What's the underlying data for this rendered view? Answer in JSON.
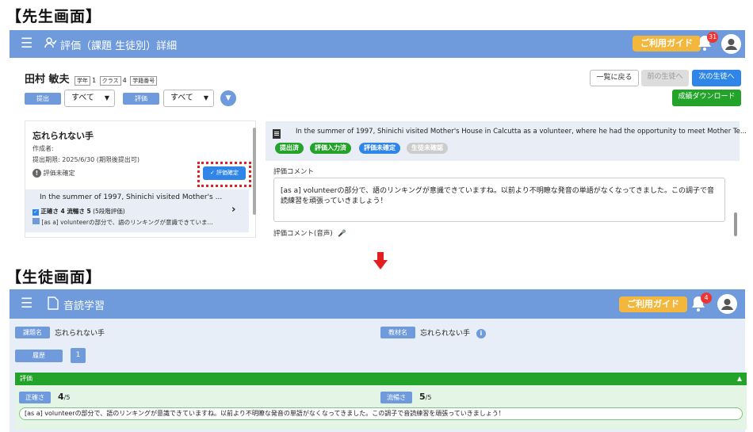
{
  "teacher_section_title": "【先生画面】",
  "student_section_title": "【生徒画面】",
  "teacher": {
    "appbar_title": "評価（課題 生徒別）詳細",
    "guide_label": "ご利用ガイド",
    "notification_count": "31",
    "student_name": "田村 敏夫",
    "grade_tag": "学年",
    "grade_value": "1",
    "class_tag": "クラス",
    "class_value": "4",
    "number_tag": "学籍番号",
    "back_to_list": "一覧に戻る",
    "prev_student": "前の生徒へ",
    "next_student": "次の生徒へ",
    "download_grades": "成績ダウンロード",
    "filter_submit_label": "提出",
    "filter_submit_value": "すべて",
    "filter_eval_label": "評価",
    "filter_eval_value": "すべて",
    "assignment_title": "忘れられない手",
    "creator_label": "作成者:",
    "deadline": "提出期限: 2025/6/30 (期限後提出可)",
    "eval_unconfirmed": "評価未確定",
    "confirm_eval_button": "評価確定",
    "list_item_text": "In the summer of 1997, Shinichi visited Mother's ...",
    "list_item_scores": "正確さ 4  流暢さ 5",
    "list_item_scale": "(5段階評価)",
    "list_item_comment": "[as a] volunteerの部分で、語のリンキングが意識できていま...",
    "passage_text": "In the summer of 1997, Shinichi visited Mother's House in Calcutta as a volunteer, where he had the opportunity to meet Mother Te...",
    "status_chips": [
      "提出済",
      "評価入力済",
      "評価未確定",
      "生徒未確認"
    ],
    "comment_label": "評価コメント",
    "comment_text": "[as a] volunteerの部分で、語のリンキングが意識できていますね。以前より不明瞭な発音の単語がなくなってきました。この調子で音読練習を頑張っていきましょう！",
    "voice_comment_label": "評価コメント(音声)"
  },
  "student": {
    "appbar_title": "音読学習",
    "guide_label": "ご利用ガイド",
    "notification_count": "4",
    "assignment_label": "課題名",
    "assignment_value": "忘れられない手",
    "material_label": "教材名",
    "material_value": "忘れられない手",
    "history_label": "履歴",
    "history_value": "1",
    "eval_header": "評価",
    "accuracy_label": "正確さ",
    "accuracy_score": "4",
    "accuracy_max": "/5",
    "fluency_label": "流暢さ",
    "fluency_score": "5",
    "fluency_max": "/5",
    "comment_text": "[as a] volunteerの部分で、語のリンキングが意識できていますね。以前より不明瞭な発音の単語がなくなってきました。この調子で音読練習を頑張っていきましょう！"
  },
  "colors": {
    "appbar": "#6f9bdc",
    "guide": "#f2b73c",
    "green": "#23a32a",
    "blue": "#2f86e8",
    "highlight": "#e41e1e"
  }
}
